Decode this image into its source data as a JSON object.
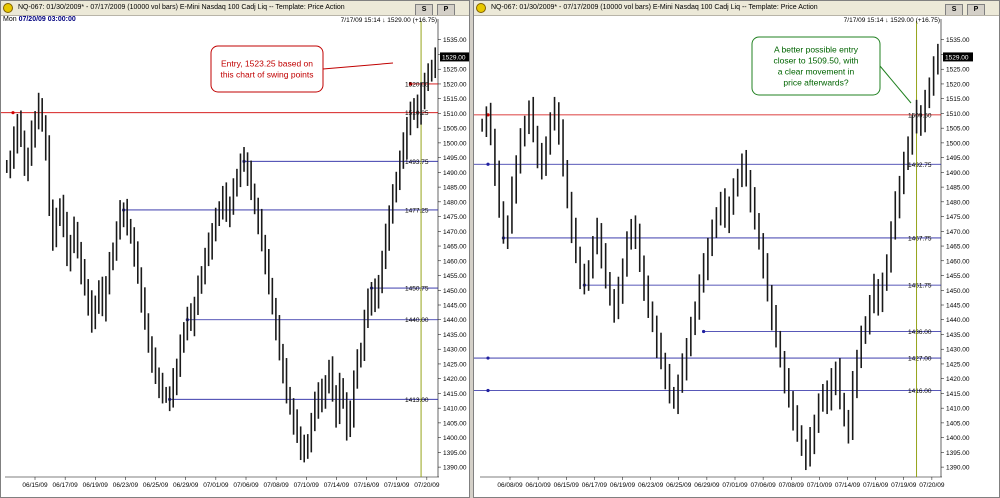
{
  "panels": [
    {
      "id": "left",
      "title": "NQ-067:  01/30/2009* - 07/17/2009  (10000 vol bars)   E-Mini Nasdaq 100 Cadj Liq   --  Template: Price Action",
      "buttons": [
        "S",
        "P"
      ],
      "date_day": "Mon",
      "date_value": "07/20/09 03:00:00",
      "info": "7/17/09 15:14  ↓ 1529.00 (+16.75)",
      "last_price_label": "1529.00",
      "annotation": [
        "Entry, 1523.25 based on",
        "this chart of swing points"
      ],
      "colors": {
        "callout_border": "#c00000",
        "callout_text": "#c00000",
        "support": "#2020a0",
        "resistance": "#d00000",
        "marker": "#8a9a00"
      }
    },
    {
      "id": "right",
      "title": "NQ-067:  01/30/2009* - 07/17/2009  (10000 vol bars)   E-Mini Nasdaq 100 Cadj Liq   --  Template: Price Action",
      "buttons": [
        "S",
        "P"
      ],
      "info": "7/17/09 15:14  ↓ 1529.00 (+16.75)",
      "last_price_label": "1529.00",
      "annotation": [
        "A better possible entry",
        "closer to 1509.50, with",
        "a clear movement in",
        "price afterwards?"
      ],
      "colors": {
        "callout_border": "#208020",
        "callout_text": "#006400",
        "support": "#2020a0",
        "resistance": "#d00000",
        "marker": "#8a9a00"
      }
    }
  ],
  "chart_data": [
    {
      "type": "line",
      "panel": "left",
      "x_tick_labels": [
        "06/15/09",
        "06/17/09",
        "06/19/09",
        "06/23/09",
        "06/25/09",
        "06/29/09",
        "07/01/09",
        "07/06/09",
        "07/08/09",
        "07/10/09",
        "07/14/09",
        "07/16/09",
        "07/19/09",
        "07/20/09"
      ],
      "ylim": [
        1388,
        1540
      ],
      "y_ticks": [
        1390,
        1395,
        1400,
        1405,
        1410,
        1415,
        1420,
        1425,
        1430,
        1435,
        1440,
        1445,
        1450,
        1455,
        1460,
        1465,
        1470,
        1475,
        1480,
        1485,
        1490,
        1495,
        1500,
        1505,
        1510,
        1515,
        1520,
        1525,
        1530,
        1535
      ],
      "series": [
        {
          "values": [
            1492,
            1494,
            1501,
            1507,
            1502,
            1491,
            1495,
            1503,
            1508,
            1513,
            1506,
            1498,
            1478,
            1468,
            1474,
            1479,
            1472,
            1461,
            1466,
            1471,
            1463,
            1456,
            1451,
            1446,
            1439,
            1446,
            1450,
            1444,
            1452,
            1459,
            1464,
            1470,
            1476,
            1477,
            1472,
            1468,
            1462,
            1455,
            1447,
            1440,
            1431,
            1426,
            1421,
            1418,
            1415,
            1414,
            1413,
            1419,
            1424,
            1431,
            1437,
            1441,
            1439,
            1445,
            1451,
            1456,
            1461,
            1465,
            1470,
            1474,
            1478,
            1482,
            1476,
            1479,
            1484,
            1489,
            1493,
            1494,
            1490,
            1484,
            1478,
            1473,
            1466,
            1460,
            1452,
            1444,
            1437,
            1429,
            1423,
            1415,
            1410,
            1405,
            1401,
            1397,
            1395,
            1399,
            1405,
            1411,
            1416,
            1412,
            1419,
            1423,
            1415,
            1408,
            1418,
            1412,
            1403,
            1408,
            1420,
            1426,
            1430,
            1440,
            1446,
            1450,
            1446,
            1453,
            1460,
            1468,
            1476,
            1482,
            1488,
            1494,
            1499,
            1506,
            1510,
            1513,
            1509,
            1516,
            1521,
            1523,
            1526,
            1529
          ]
        }
      ],
      "horizontal_levels": [
        {
          "value": 1520.0,
          "label": "1520.00",
          "kind": "resistance",
          "start_index": 114
        },
        {
          "value": 1510.25,
          "label": "1510.25",
          "kind": "resistance",
          "start_index": 0
        },
        {
          "value": 1493.75,
          "label": "1493.75",
          "kind": "support",
          "start_index": 67
        },
        {
          "value": 1477.25,
          "label": "1477.25",
          "kind": "support",
          "start_index": 33
        },
        {
          "value": 1450.75,
          "label": "1450.75",
          "kind": "support",
          "start_index": 103
        },
        {
          "value": 1440.0,
          "label": "1440.00",
          "kind": "support",
          "start_index": 51
        },
        {
          "value": 1413.0,
          "label": "1413.00",
          "kind": "support",
          "start_index": 46
        }
      ],
      "vertical_marker_index": 117
    },
    {
      "type": "line",
      "panel": "right",
      "x_tick_labels": [
        "06/08/09",
        "06/10/09",
        "06/15/09",
        "06/17/09",
        "06/19/09",
        "06/23/09",
        "06/25/09",
        "06/29/09",
        "07/01/09",
        "07/06/09",
        "07/08/09",
        "07/10/09",
        "07/14/09",
        "07/16/09",
        "07/19/09",
        "07/20/09"
      ],
      "ylim": [
        1388,
        1540
      ],
      "y_ticks": [
        1390,
        1395,
        1400,
        1405,
        1410,
        1415,
        1420,
        1425,
        1430,
        1435,
        1440,
        1445,
        1450,
        1455,
        1460,
        1465,
        1470,
        1475,
        1480,
        1485,
        1490,
        1495,
        1500,
        1505,
        1510,
        1515,
        1520,
        1525,
        1530,
        1535
      ],
      "series": [
        {
          "values": [
            1506,
            1509,
            1502,
            1490,
            1478,
            1468,
            1472,
            1484,
            1493,
            1501,
            1507,
            1511,
            1503,
            1496,
            1491,
            1500,
            1507,
            1511,
            1504,
            1492,
            1480,
            1470,
            1462,
            1455,
            1452,
            1458,
            1465,
            1470,
            1462,
            1454,
            1447,
            1443,
            1450,
            1458,
            1466,
            1472,
            1468,
            1459,
            1451,
            1444,
            1438,
            1431,
            1426,
            1421,
            1415,
            1412,
            1418,
            1424,
            1431,
            1437,
            1444,
            1452,
            1458,
            1465,
            1470,
            1476,
            1480,
            1474,
            1479,
            1484,
            1489,
            1493,
            1488,
            1481,
            1474,
            1466,
            1458,
            1449,
            1441,
            1434,
            1426,
            1419,
            1413,
            1407,
            1402,
            1396,
            1393,
            1399,
            1405,
            1411,
            1416,
            1412,
            1419,
            1423,
            1413,
            1406,
            1402,
            1418,
            1427,
            1434,
            1439,
            1445,
            1451,
            1446,
            1452,
            1460,
            1470,
            1479,
            1486,
            1493,
            1500,
            1506,
            1510,
            1507,
            1514,
            1520,
            1526,
            1529
          ]
        }
      ],
      "horizontal_levels": [
        {
          "value": 1509.5,
          "label": "1509.50",
          "kind": "resistance",
          "start_index": 0
        },
        {
          "value": 1492.75,
          "label": "1492.75",
          "kind": "support",
          "start_index": 0
        },
        {
          "value": 1467.75,
          "label": "1467.75",
          "kind": "support",
          "start_index": 5
        },
        {
          "value": 1451.75,
          "label": "1451.75",
          "kind": "support",
          "start_index": 24
        },
        {
          "value": 1436.0,
          "label": "1436.00",
          "kind": "support",
          "start_index": 52
        },
        {
          "value": 1427.0,
          "label": "1427.00",
          "kind": "support",
          "start_index": 0
        },
        {
          "value": 1416.0,
          "label": "1416.00",
          "kind": "support",
          "start_index": 0
        }
      ],
      "vertical_marker_index": 102
    }
  ]
}
